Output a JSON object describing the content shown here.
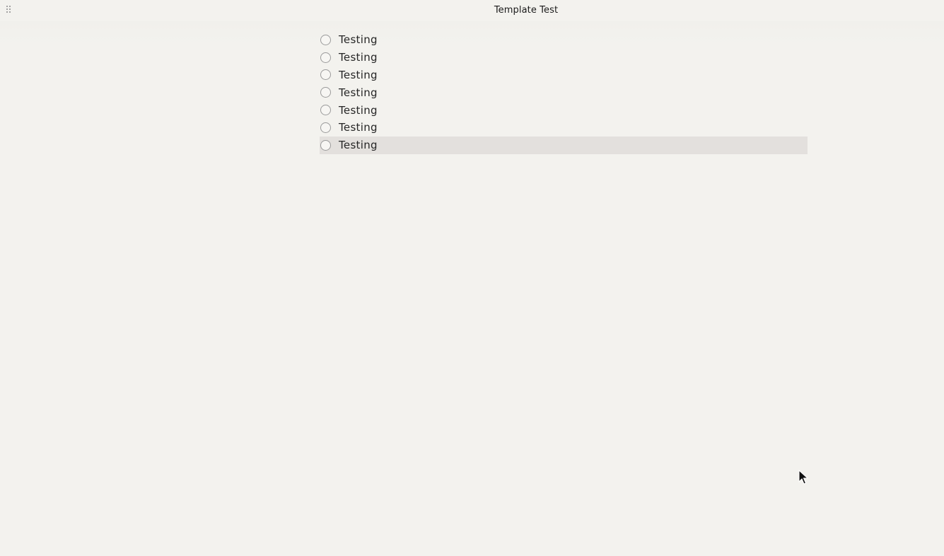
{
  "window": {
    "title": "Template Test",
    "drag_handle_icon": "drag-handle-icon"
  },
  "checklist": {
    "items": [
      {
        "label": "Testing",
        "checked": false,
        "selected": false
      },
      {
        "label": "Testing",
        "checked": false,
        "selected": false
      },
      {
        "label": "Testing",
        "checked": false,
        "selected": false
      },
      {
        "label": "Testing",
        "checked": false,
        "selected": false
      },
      {
        "label": "Testing",
        "checked": false,
        "selected": false
      },
      {
        "label": "Testing",
        "checked": false,
        "selected": false
      },
      {
        "label": "Testing",
        "checked": false,
        "selected": true
      }
    ]
  },
  "colors": {
    "background": "#f3f2ee",
    "selected_row": "#e3e0dd",
    "checkbox_border": "#9b9b9b",
    "text": "#262626"
  }
}
